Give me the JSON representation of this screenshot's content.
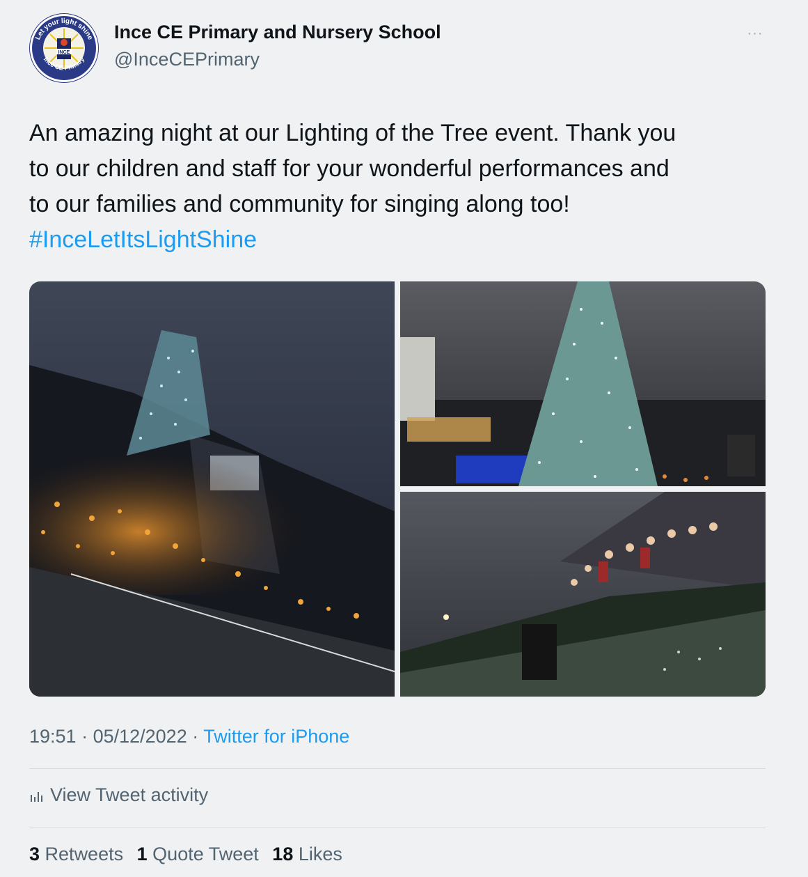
{
  "author": {
    "name": "Ince CE Primary and Nursery School",
    "handle": "@InceCEPrimary",
    "avatar_ring_text_top": "Let your light shine",
    "avatar_ring_text_bottom": "Ince CE Primary",
    "avatar_center_text": "INCE"
  },
  "more_label": "···",
  "tweet": {
    "lines": [
      "An amazing night at our Lighting of the Tree event. Thank you",
      "to our children and staff for your wonderful performances and",
      "to our families and community for singing along too!"
    ],
    "hashtag": "#InceLetItsLightShine"
  },
  "media": [
    {
      "icon": "photo-tree-crowd-candles"
    },
    {
      "icon": "photo-christmas-tree-lit"
    },
    {
      "icon": "photo-crowd-courtyard"
    }
  ],
  "meta": {
    "time": "19:51",
    "sep1": " · ",
    "date": "05/12/2022",
    "sep2": " · ",
    "source": "Twitter for iPhone"
  },
  "activity": {
    "label": "View Tweet activity"
  },
  "stats": {
    "retweets_count": "3",
    "retweets_label": "Retweets",
    "quotes_count": "1",
    "quotes_label": "Quote Tweet",
    "likes_count": "18",
    "likes_label": "Likes"
  },
  "colors": {
    "link": "#1d9bf0",
    "secondary": "#536471",
    "background": "#eff1f3"
  }
}
